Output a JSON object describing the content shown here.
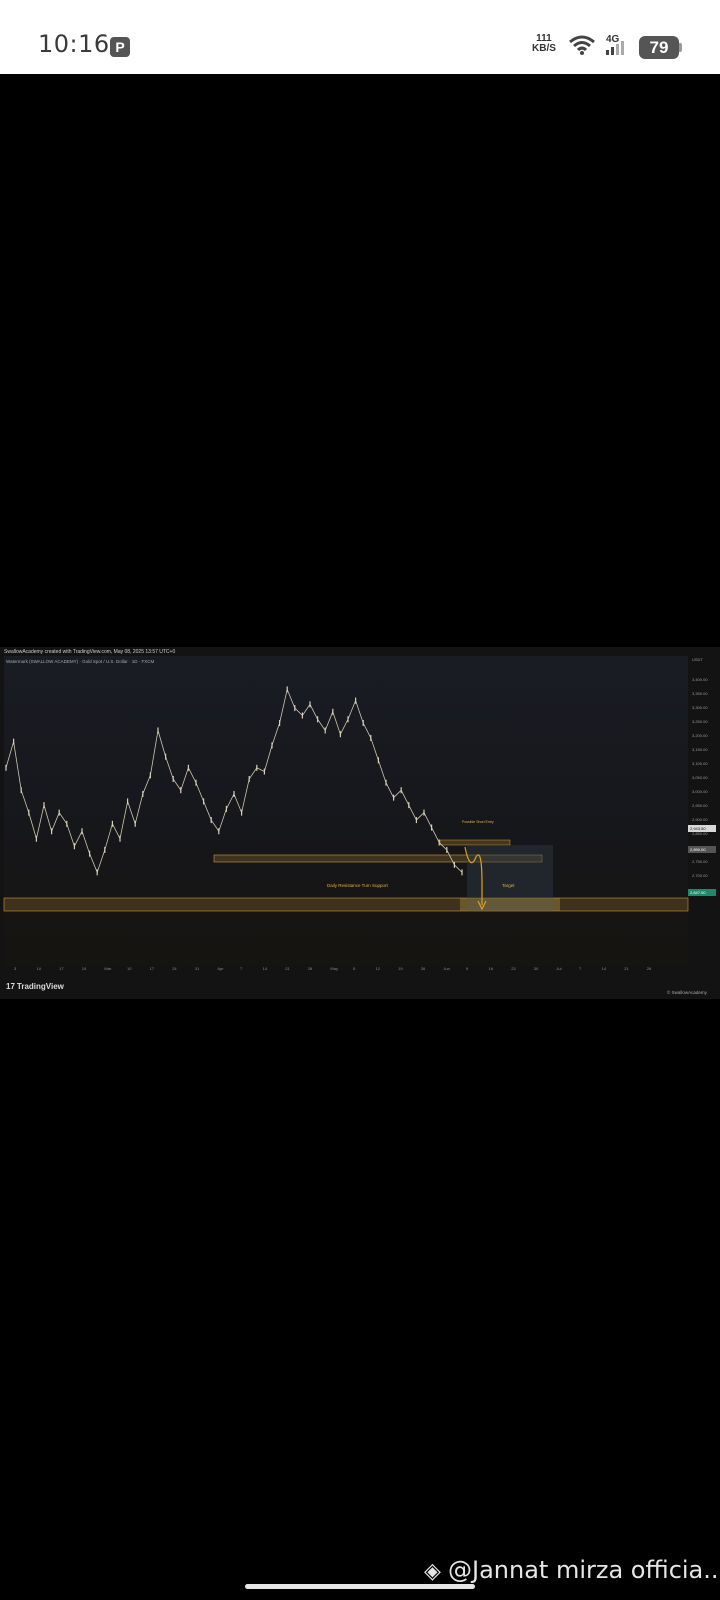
{
  "status_bar": {
    "time": "10:16",
    "app_badge": "P",
    "net_speed_value": "111",
    "net_speed_unit": "KB/S",
    "network_type": "4G",
    "battery": "79"
  },
  "chart": {
    "header": "SwallowAcademy created with TradingView.com, May 08, 2025 13:57 UTC+0",
    "subheader": "Watermark (SWALLOW ACADEMY) · Gold Spot / U.S. Dollar · 1D · FXCM",
    "currency_label": "USDT",
    "price_ticks": [
      "3,400.00",
      "3,350.00",
      "3,300.00",
      "3,250.00",
      "3,200.00",
      "3,150.00",
      "3,100.00",
      "3,050.00",
      "3,000.00",
      "2,950.00",
      "2,900.00",
      "2,850.00",
      "2,800.00",
      "2,750.00",
      "2,700.00"
    ],
    "price_tags": [
      "2,943.50",
      "2,890.00",
      "2,847.00"
    ],
    "date_ticks": [
      "3",
      "10",
      "17",
      "24",
      "Mar",
      "10",
      "17",
      "24",
      "31",
      "Apr",
      "7",
      "14",
      "21",
      "28",
      "May",
      "5",
      "12",
      "19",
      "26",
      "Jun",
      "9",
      "16",
      "23",
      "30",
      "Jul",
      "7",
      "14",
      "21",
      "28"
    ],
    "zone_labels": {
      "support": "Daily Resistance Turn Support",
      "target": "Target",
      "short_entry": "Possible Short Entry"
    },
    "brand": "TradingView",
    "brand_mark": "17",
    "credit": "© SwallowAcademy"
  },
  "watermark": {
    "text": "@Jannat mirza officia..."
  },
  "chart_data": {
    "type": "line",
    "title": "",
    "xlabel": "",
    "ylabel": "",
    "ylim": [
      2700,
      3450
    ],
    "series": [
      {
        "values": [
          3180,
          3250,
          3120,
          3060,
          2990,
          3080,
          3010,
          3060,
          3030,
          2970,
          3010,
          2950,
          2900,
          2960,
          3030,
          2990,
          3090,
          3030,
          3110,
          3160,
          3280,
          3210,
          3150,
          3120,
          3180,
          3140,
          3090,
          3040,
          3010,
          3070,
          3110,
          3060,
          3150,
          3180,
          3170,
          3240,
          3300,
          3390,
          3340,
          3320,
          3350,
          3310,
          3280,
          3330,
          3270,
          3310,
          3360,
          3300,
          3260,
          3200,
          3140,
          3100,
          3120,
          3080,
          3040,
          3060,
          3020,
          2980,
          2960,
          2920,
          2900
        ]
      }
    ]
  }
}
